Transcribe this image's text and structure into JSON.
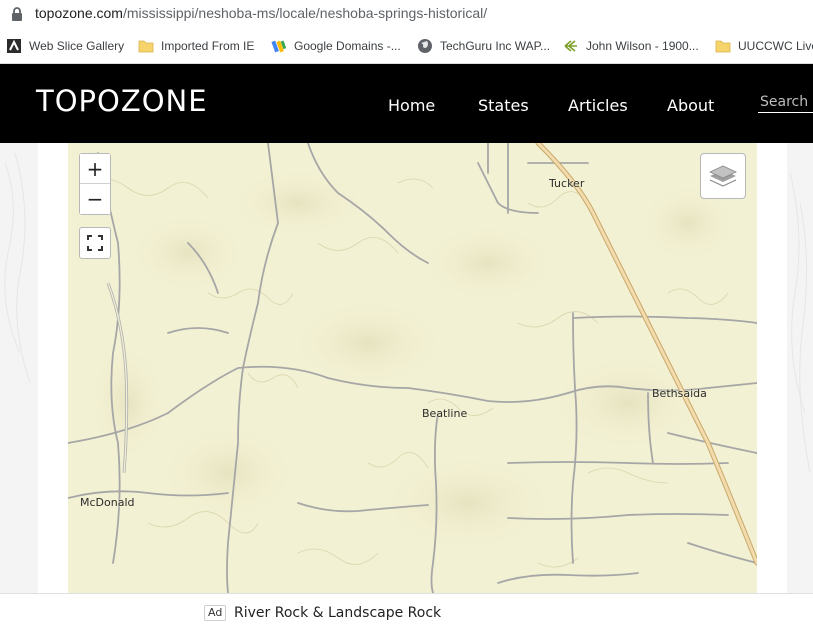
{
  "browser": {
    "url_domain": "topozone.com",
    "url_path": "/mississippi/neshoba-ms/locale/neshoba-springs-historical/"
  },
  "bookmarks": [
    {
      "label": "Web Slice Gallery",
      "icon": "web-slice-icon"
    },
    {
      "label": "Imported From IE",
      "icon": "folder-icon"
    },
    {
      "label": "Google Domains -...",
      "icon": "google-domains-icon"
    },
    {
      "label": "TechGuru Inc WAP...",
      "icon": "globe-icon"
    },
    {
      "label": "John Wilson - 1900...",
      "icon": "ancestry-leaf-icon"
    },
    {
      "label": "UUCCWC Live",
      "icon": "folder-icon"
    }
  ],
  "site": {
    "logo": "TOPOZONE",
    "nav": [
      "Home",
      "States",
      "Articles",
      "About"
    ],
    "search_placeholder": "Search"
  },
  "map": {
    "zoom_in": "+",
    "zoom_out": "−",
    "places": [
      "Tucker",
      "Bethsaida",
      "Beatline",
      "McDonald"
    ],
    "colors": {
      "terrain": "#f3f1d3",
      "road": "#9a9a9a",
      "highway": "#e8c98f"
    }
  },
  "ad": {
    "badge": "Ad",
    "text": "River Rock & Landscape Rock"
  }
}
